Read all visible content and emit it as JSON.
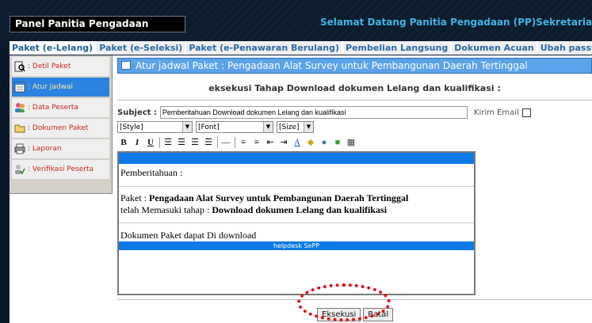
{
  "header": {
    "panel_title": "Panel Panitia Pengadaan",
    "welcome": "Selamat Datang Panitia Pengadaan (PP)Sekretariat Jendera"
  },
  "tabs": [
    {
      "label": "Paket (e-Lelang)",
      "active": true
    },
    {
      "label": "Paket (e-Seleksi)"
    },
    {
      "label": "Paket (e-Penawaran Berulang)"
    },
    {
      "label": "Pembelian Langsung"
    },
    {
      "label": "Dokumen Acuan"
    },
    {
      "label": "Ubah password"
    }
  ],
  "sidebar": {
    "items": [
      {
        "label": ": Detil Paket",
        "icon": "magnifier-doc-icon"
      },
      {
        "label": ": Atur Jadwal",
        "icon": "schedule-window-icon",
        "active": true
      },
      {
        "label": ": Data Peserta",
        "icon": "users-icon"
      },
      {
        "label": ": Dokumen Paket",
        "icon": "folder-icon"
      },
      {
        "label": ": Laporan",
        "icon": "printer-icon"
      },
      {
        "label": ": Verifikasi Peserta",
        "icon": "user-check-icon"
      }
    ]
  },
  "main": {
    "header": "Atur jadwal Paket : Pengadaan Alat Survey untuk Pembangunan Daerah Tertinggal",
    "sub_title": "eksekusi Tahap Download dokumen Lelang dan kualifikasi :",
    "subject_label": "Subject :",
    "subject_value": "Pemberitahuan Download dokumen Lelang dan kualifikasi",
    "kirim_email_label": "Kirim Email",
    "selects": {
      "style": "[Style]",
      "font": "[Font]",
      "size": "[Size]"
    },
    "editor": {
      "line1": "Pemberitahuan :",
      "paket_prefix": "Paket : ",
      "paket_name": "Pengadaan Alat Survey untuk Pembangunan Daerah Tertinggal",
      "tahap_prefix": "telah Memasuki tahap : ",
      "tahap_name": "Download dokumen Lelang dan kualifikasi",
      "line4": "Dokumen Paket dapat Di download",
      "helpdesk": "helpdesk SePP"
    },
    "buttons": {
      "eksekusi": "Eksekusi",
      "batal": "Batal"
    }
  },
  "colors": {
    "header_bg": "#0d1c2c",
    "tab_text": "#2a6aa5",
    "main_header_bg": "#5aa2ea",
    "editor_bar": "#0d7ae6",
    "annotation": "#e01010"
  }
}
